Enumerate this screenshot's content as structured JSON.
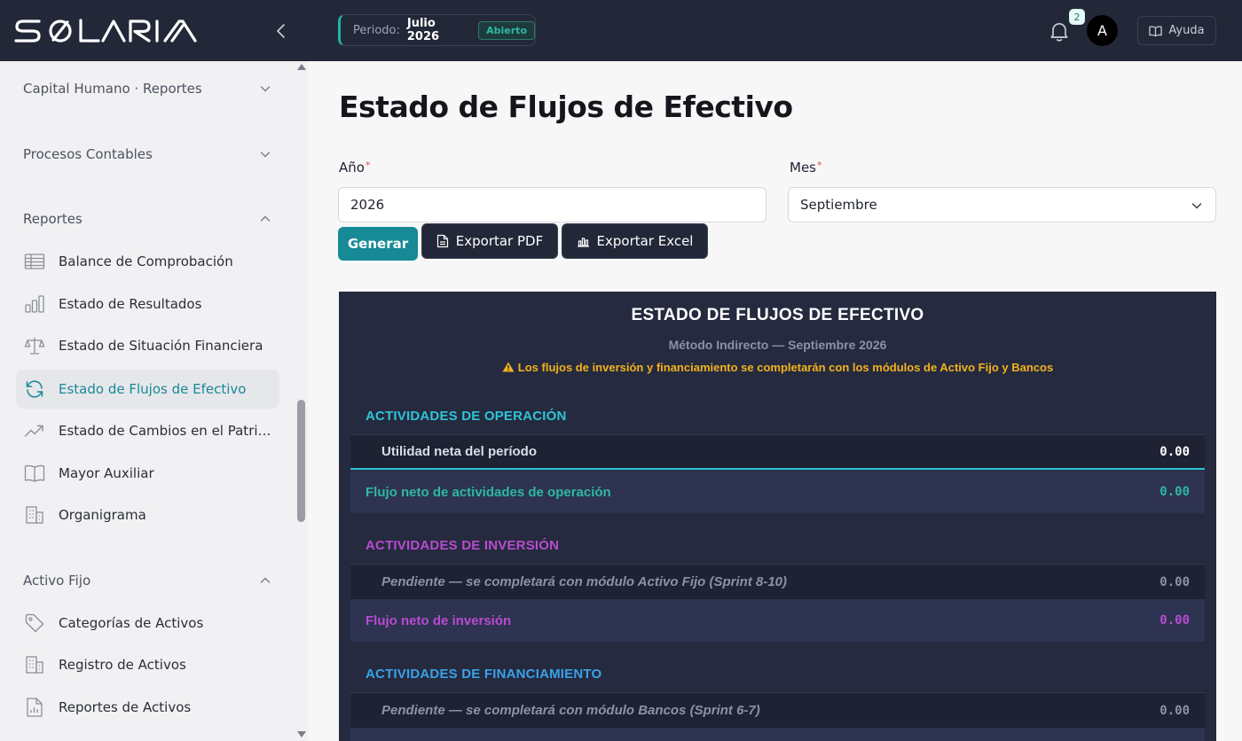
{
  "app": {
    "logo_text": "SOLARIA"
  },
  "topbar": {
    "period_label": "Periodo:",
    "period_value": "Julio 2026",
    "period_status": "Abierto",
    "notification_count": "2",
    "avatar_initial": "A",
    "help_label": "Ayuda"
  },
  "sidebar": {
    "sections": {
      "capital": "Capital Humano · Reportes",
      "procesos": "Procesos Contables",
      "reportes": "Reportes",
      "activo": "Activo Fijo"
    },
    "reportes_items": [
      {
        "label": "Balance de Comprobación",
        "icon": "table-icon"
      },
      {
        "label": "Estado de Resultados",
        "icon": "bar-chart-icon"
      },
      {
        "label": "Estado de Situación Financiera",
        "icon": "scale-icon"
      },
      {
        "label": "Estado de Flujos de Efectivo",
        "icon": "refresh-icon"
      },
      {
        "label": "Estado de Cambios en el Patrimonio",
        "icon": "trend-up-icon"
      },
      {
        "label": "Mayor Auxiliar",
        "icon": "book-icon"
      },
      {
        "label": "Organigrama",
        "icon": "building-icon"
      }
    ],
    "activo_items": [
      {
        "label": "Categorías de Activos",
        "icon": "tag-icon"
      },
      {
        "label": "Registro de Activos",
        "icon": "building-icon"
      },
      {
        "label": "Reportes de Activos",
        "icon": "report-file-icon"
      }
    ],
    "active_index": 3
  },
  "main": {
    "title": "Estado de Flujos de Efectivo",
    "year_label": "Año",
    "year_value": "2026",
    "month_label": "Mes",
    "month_value": "Septiembre",
    "generate_label": "Generar",
    "export_pdf_label": "Exportar PDF",
    "export_excel_label": "Exportar Excel"
  },
  "report": {
    "title": "ESTADO DE FLUJOS DE EFECTIVO",
    "subtitle": "Método Indirecto — Septiembre 2026",
    "warning": "Los flujos de inversión y financiamiento se completarán con los módulos de Activo Fijo y Bancos",
    "operacion": {
      "heading": "ACTIVIDADES DE OPERACIÓN",
      "line_label": "Utilidad neta del período",
      "line_amount": "0.00",
      "total_label": "Flujo neto de actividades de operación",
      "total_amount": "0.00"
    },
    "inversion": {
      "heading": "ACTIVIDADES DE INVERSIÓN",
      "line_label": "Pendiente — se completará con módulo Activo Fijo (Sprint 8-10)",
      "line_amount": "0.00",
      "total_label": "Flujo neto de inversión",
      "total_amount": "0.00"
    },
    "financiamiento": {
      "heading": "ACTIVIDADES DE FINANCIAMIENTO",
      "line_label": "Pendiente — se completará con módulo Bancos (Sprint 6-7)",
      "line_amount": "0.00"
    }
  },
  "colors": {
    "topbar": "#232838",
    "accent_teal": "#168a96",
    "operacion": "#2ec3d6",
    "inversion": "#b94bd1",
    "financiamiento": "#3aa2e8",
    "warning": "#f2b21d"
  }
}
